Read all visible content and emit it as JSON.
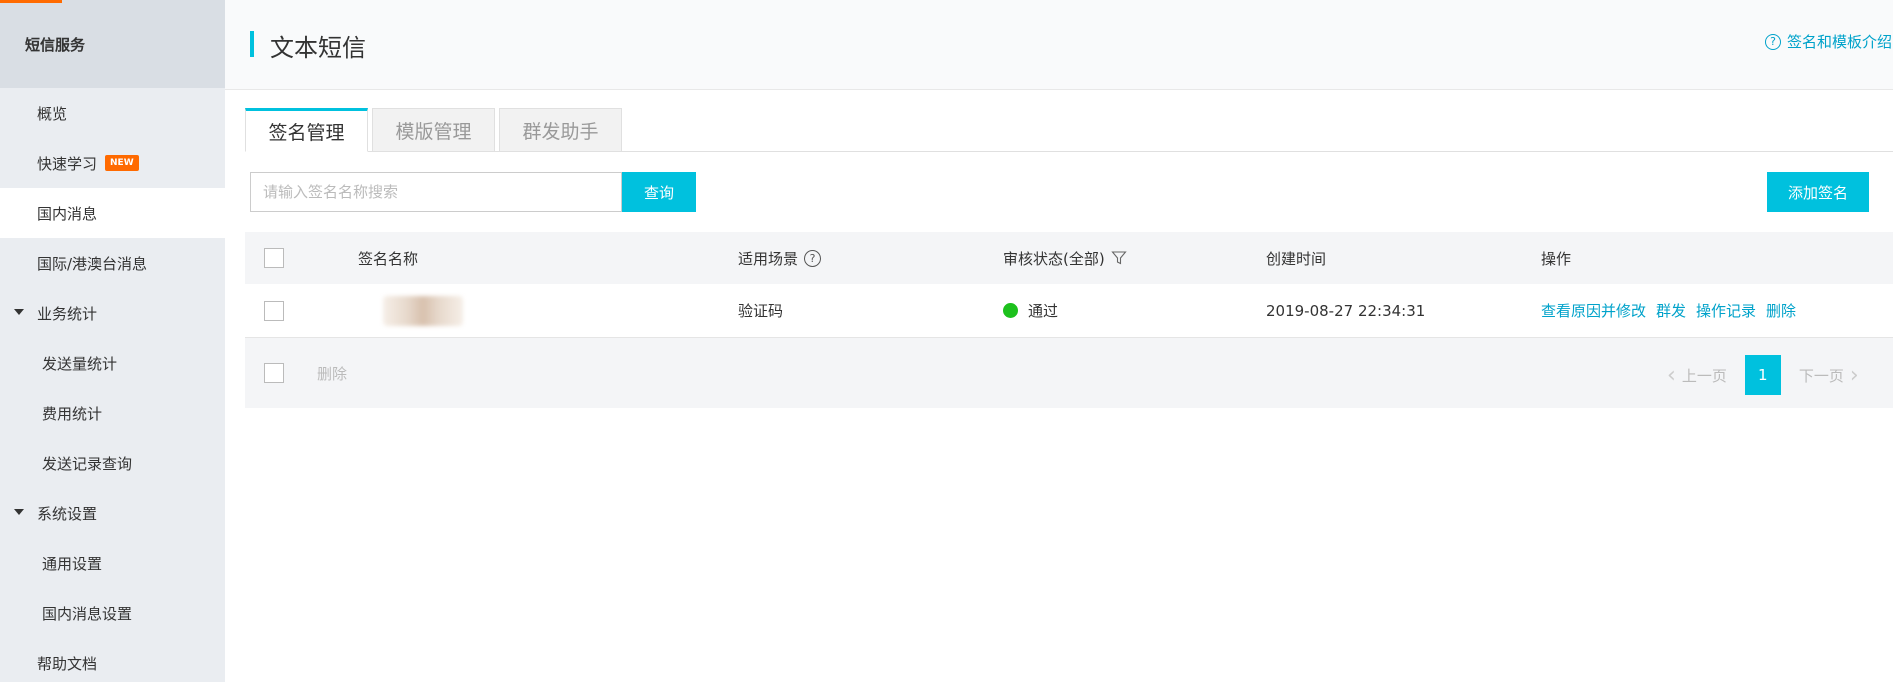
{
  "sidebar": {
    "title": "短信服务",
    "items": [
      {
        "label": "概览"
      },
      {
        "label": "快速学习",
        "badge": "NEW"
      },
      {
        "label": "国内消息"
      },
      {
        "label": "国际/港澳台消息"
      },
      {
        "label": "业务统计"
      },
      {
        "label": "发送量统计"
      },
      {
        "label": "费用统计"
      },
      {
        "label": "发送记录查询"
      },
      {
        "label": "系统设置"
      },
      {
        "label": "通用设置"
      },
      {
        "label": "国内消息设置"
      },
      {
        "label": "帮助文档"
      }
    ]
  },
  "header": {
    "title": "文本短信",
    "help_link": "签名和模板介绍"
  },
  "tabs": [
    {
      "label": "签名管理"
    },
    {
      "label": "模版管理"
    },
    {
      "label": "群发助手"
    }
  ],
  "toolbar": {
    "search_placeholder": "请输入签名名称搜索",
    "query_label": "查询",
    "add_label": "添加签名"
  },
  "table": {
    "columns": [
      "签名名称",
      "适用场景",
      "审核状态(全部)",
      "创建时间",
      "操作"
    ],
    "rows": [
      {
        "scene": "验证码",
        "status": "通过",
        "created": "2019-08-27 22:34:31",
        "actions": [
          "查看原因并修改",
          "群发",
          "操作记录",
          "删除"
        ]
      }
    ],
    "footer": {
      "delete_label": "删除",
      "prev_label": "上一页",
      "current_page": "1",
      "next_label": "下一页"
    }
  },
  "colors": {
    "accent": "#00c1de",
    "link": "#00a2ca",
    "status_pass": "#1dc11d",
    "badge": "#ff6a00"
  }
}
